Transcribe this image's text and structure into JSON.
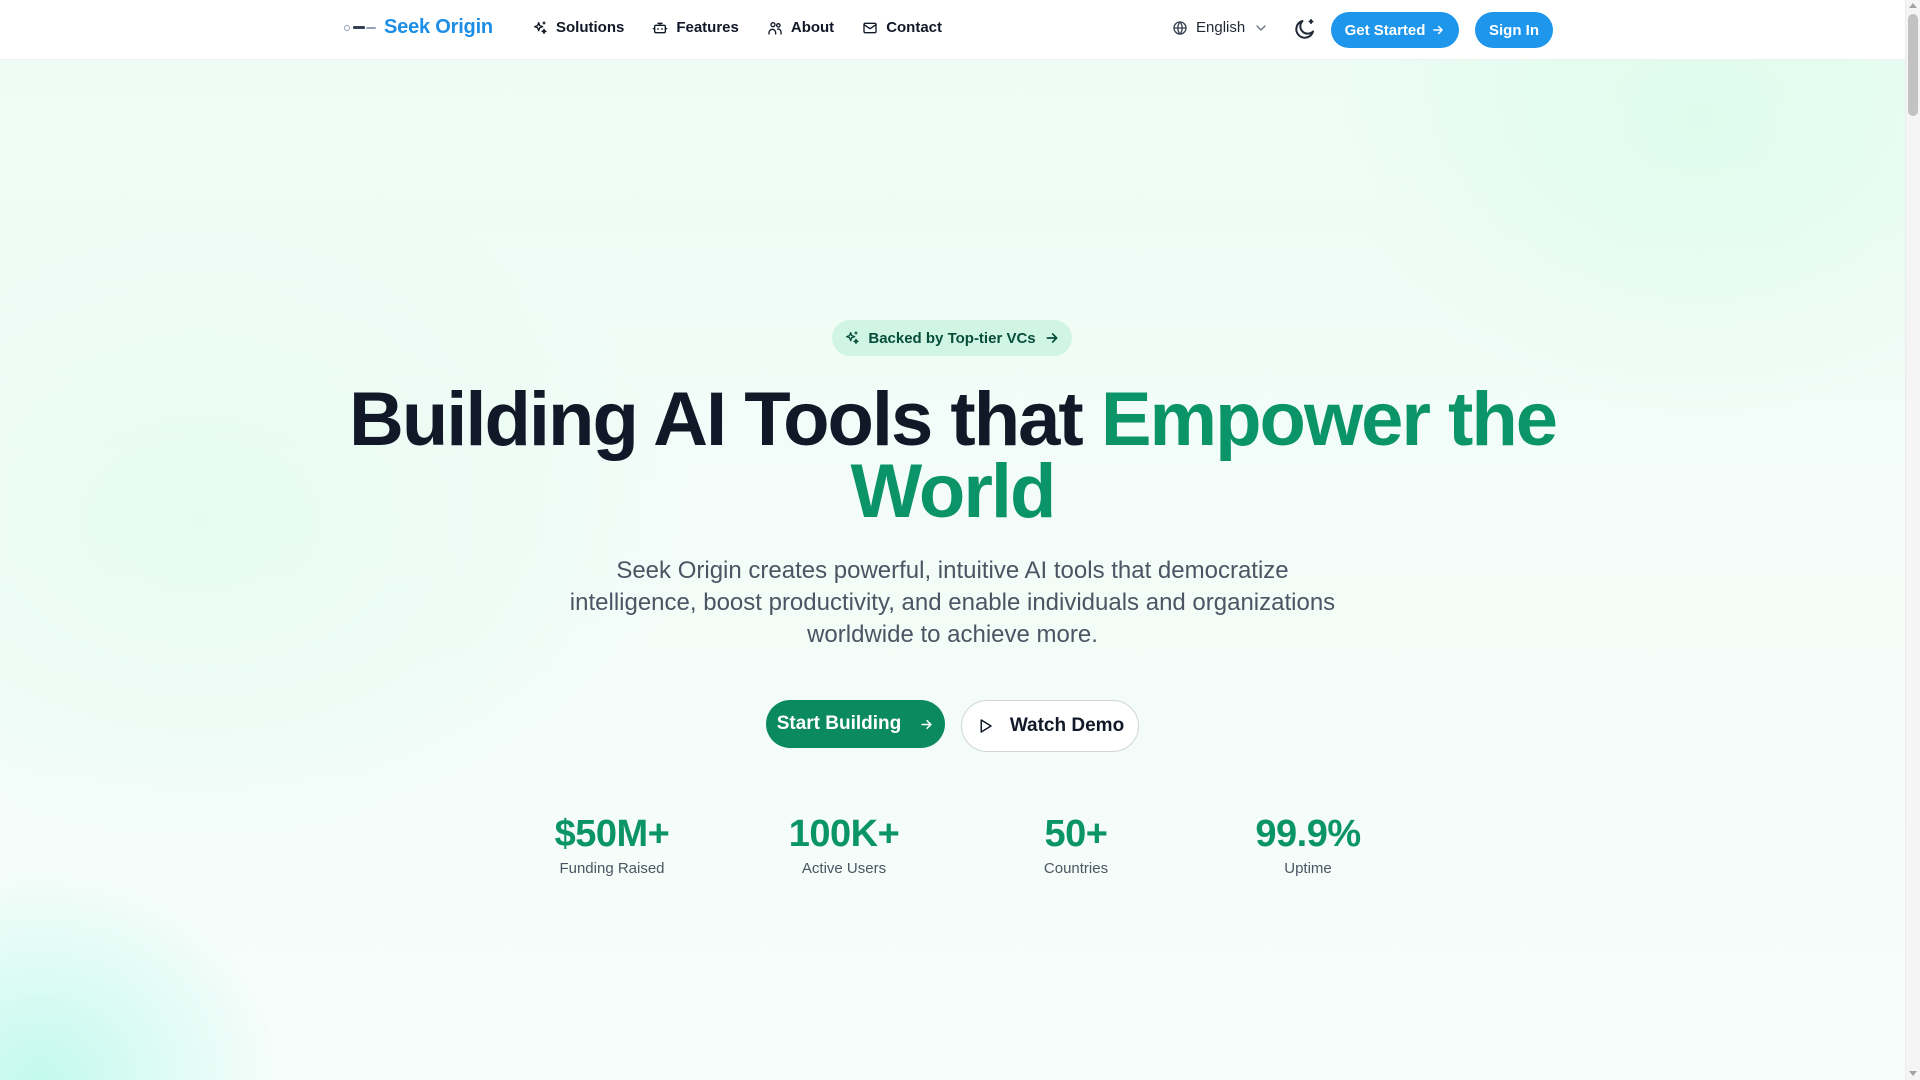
{
  "header": {
    "brand": "Seek Origin",
    "nav": [
      {
        "label": "Solutions",
        "icon": "sparkles-icon"
      },
      {
        "label": "Features",
        "icon": "bot-icon"
      },
      {
        "label": "About",
        "icon": "users-icon"
      },
      {
        "label": "Contact",
        "icon": "mail-icon"
      }
    ],
    "language": "English",
    "get_started": "Get Started",
    "sign_in": "Sign In"
  },
  "hero": {
    "badge": "Backed by Top-tier VCs",
    "headline_main": "Building AI Tools that ",
    "headline_accent": "Empower the World",
    "subtitle": "Seek Origin creates powerful, intuitive AI tools that democratize intelligence, boost productivity, and enable individuals and organizations worldwide to achieve more.",
    "primary_cta": "Start Building",
    "secondary_cta": "Watch Demo"
  },
  "stats": [
    {
      "value": "$50M+",
      "label": "Funding Raised"
    },
    {
      "value": "100K+",
      "label": "Active Users"
    },
    {
      "value": "50+",
      "label": "Countries"
    },
    {
      "value": "99.9%",
      "label": "Uptime"
    }
  ],
  "colors": {
    "brand_blue": "#1d96ec",
    "accent_green": "#0a9467",
    "cta_green": "#0b8a60",
    "badge_bg": "#d1f5e4"
  }
}
